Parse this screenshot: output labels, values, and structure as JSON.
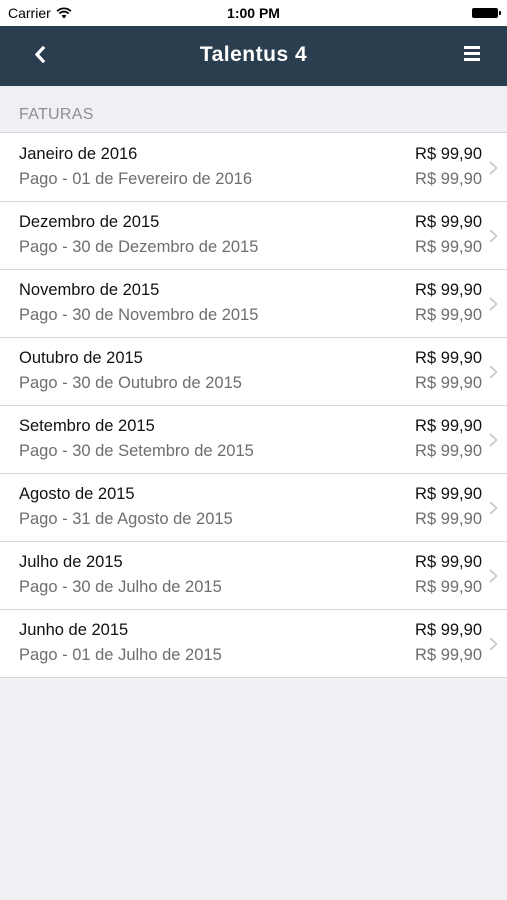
{
  "status_bar": {
    "carrier": "Carrier",
    "time": "1:00 PM"
  },
  "nav": {
    "title": "Talentus 4",
    "back_icon": "chevron-left-icon",
    "menu_icon": "hamburger-menu-icon"
  },
  "section": {
    "title": "FATURAS"
  },
  "invoices": [
    {
      "month": "Janeiro de 2016",
      "status": "Pago - 01 de Fevereiro de 2016",
      "amount": "R$ 99,90",
      "paid": "R$ 99,90"
    },
    {
      "month": "Dezembro de 2015",
      "status": "Pago - 30 de Dezembro de 2015",
      "amount": "R$ 99,90",
      "paid": "R$ 99,90"
    },
    {
      "month": "Novembro de 2015",
      "status": "Pago - 30 de Novembro de 2015",
      "amount": "R$ 99,90",
      "paid": "R$ 99,90"
    },
    {
      "month": "Outubro de 2015",
      "status": "Pago - 30 de Outubro de 2015",
      "amount": "R$ 99,90",
      "paid": "R$ 99,90"
    },
    {
      "month": "Setembro de 2015",
      "status": "Pago - 30 de Setembro de 2015",
      "amount": "R$ 99,90",
      "paid": "R$ 99,90"
    },
    {
      "month": "Agosto de 2015",
      "status": "Pago - 31 de Agosto de 2015",
      "amount": "R$ 99,90",
      "paid": "R$ 99,90"
    },
    {
      "month": "Julho de 2015",
      "status": "Pago - 30 de Julho de 2015",
      "amount": "R$ 99,90",
      "paid": "R$ 99,90"
    },
    {
      "month": "Junho de 2015",
      "status": "Pago - 01 de Julho de 2015",
      "amount": "R$ 99,90",
      "paid": "R$ 99,90"
    }
  ],
  "colors": {
    "nav_background": "#2b3e4f",
    "page_background": "#efeff4",
    "secondary_text": "#6d6d72"
  }
}
